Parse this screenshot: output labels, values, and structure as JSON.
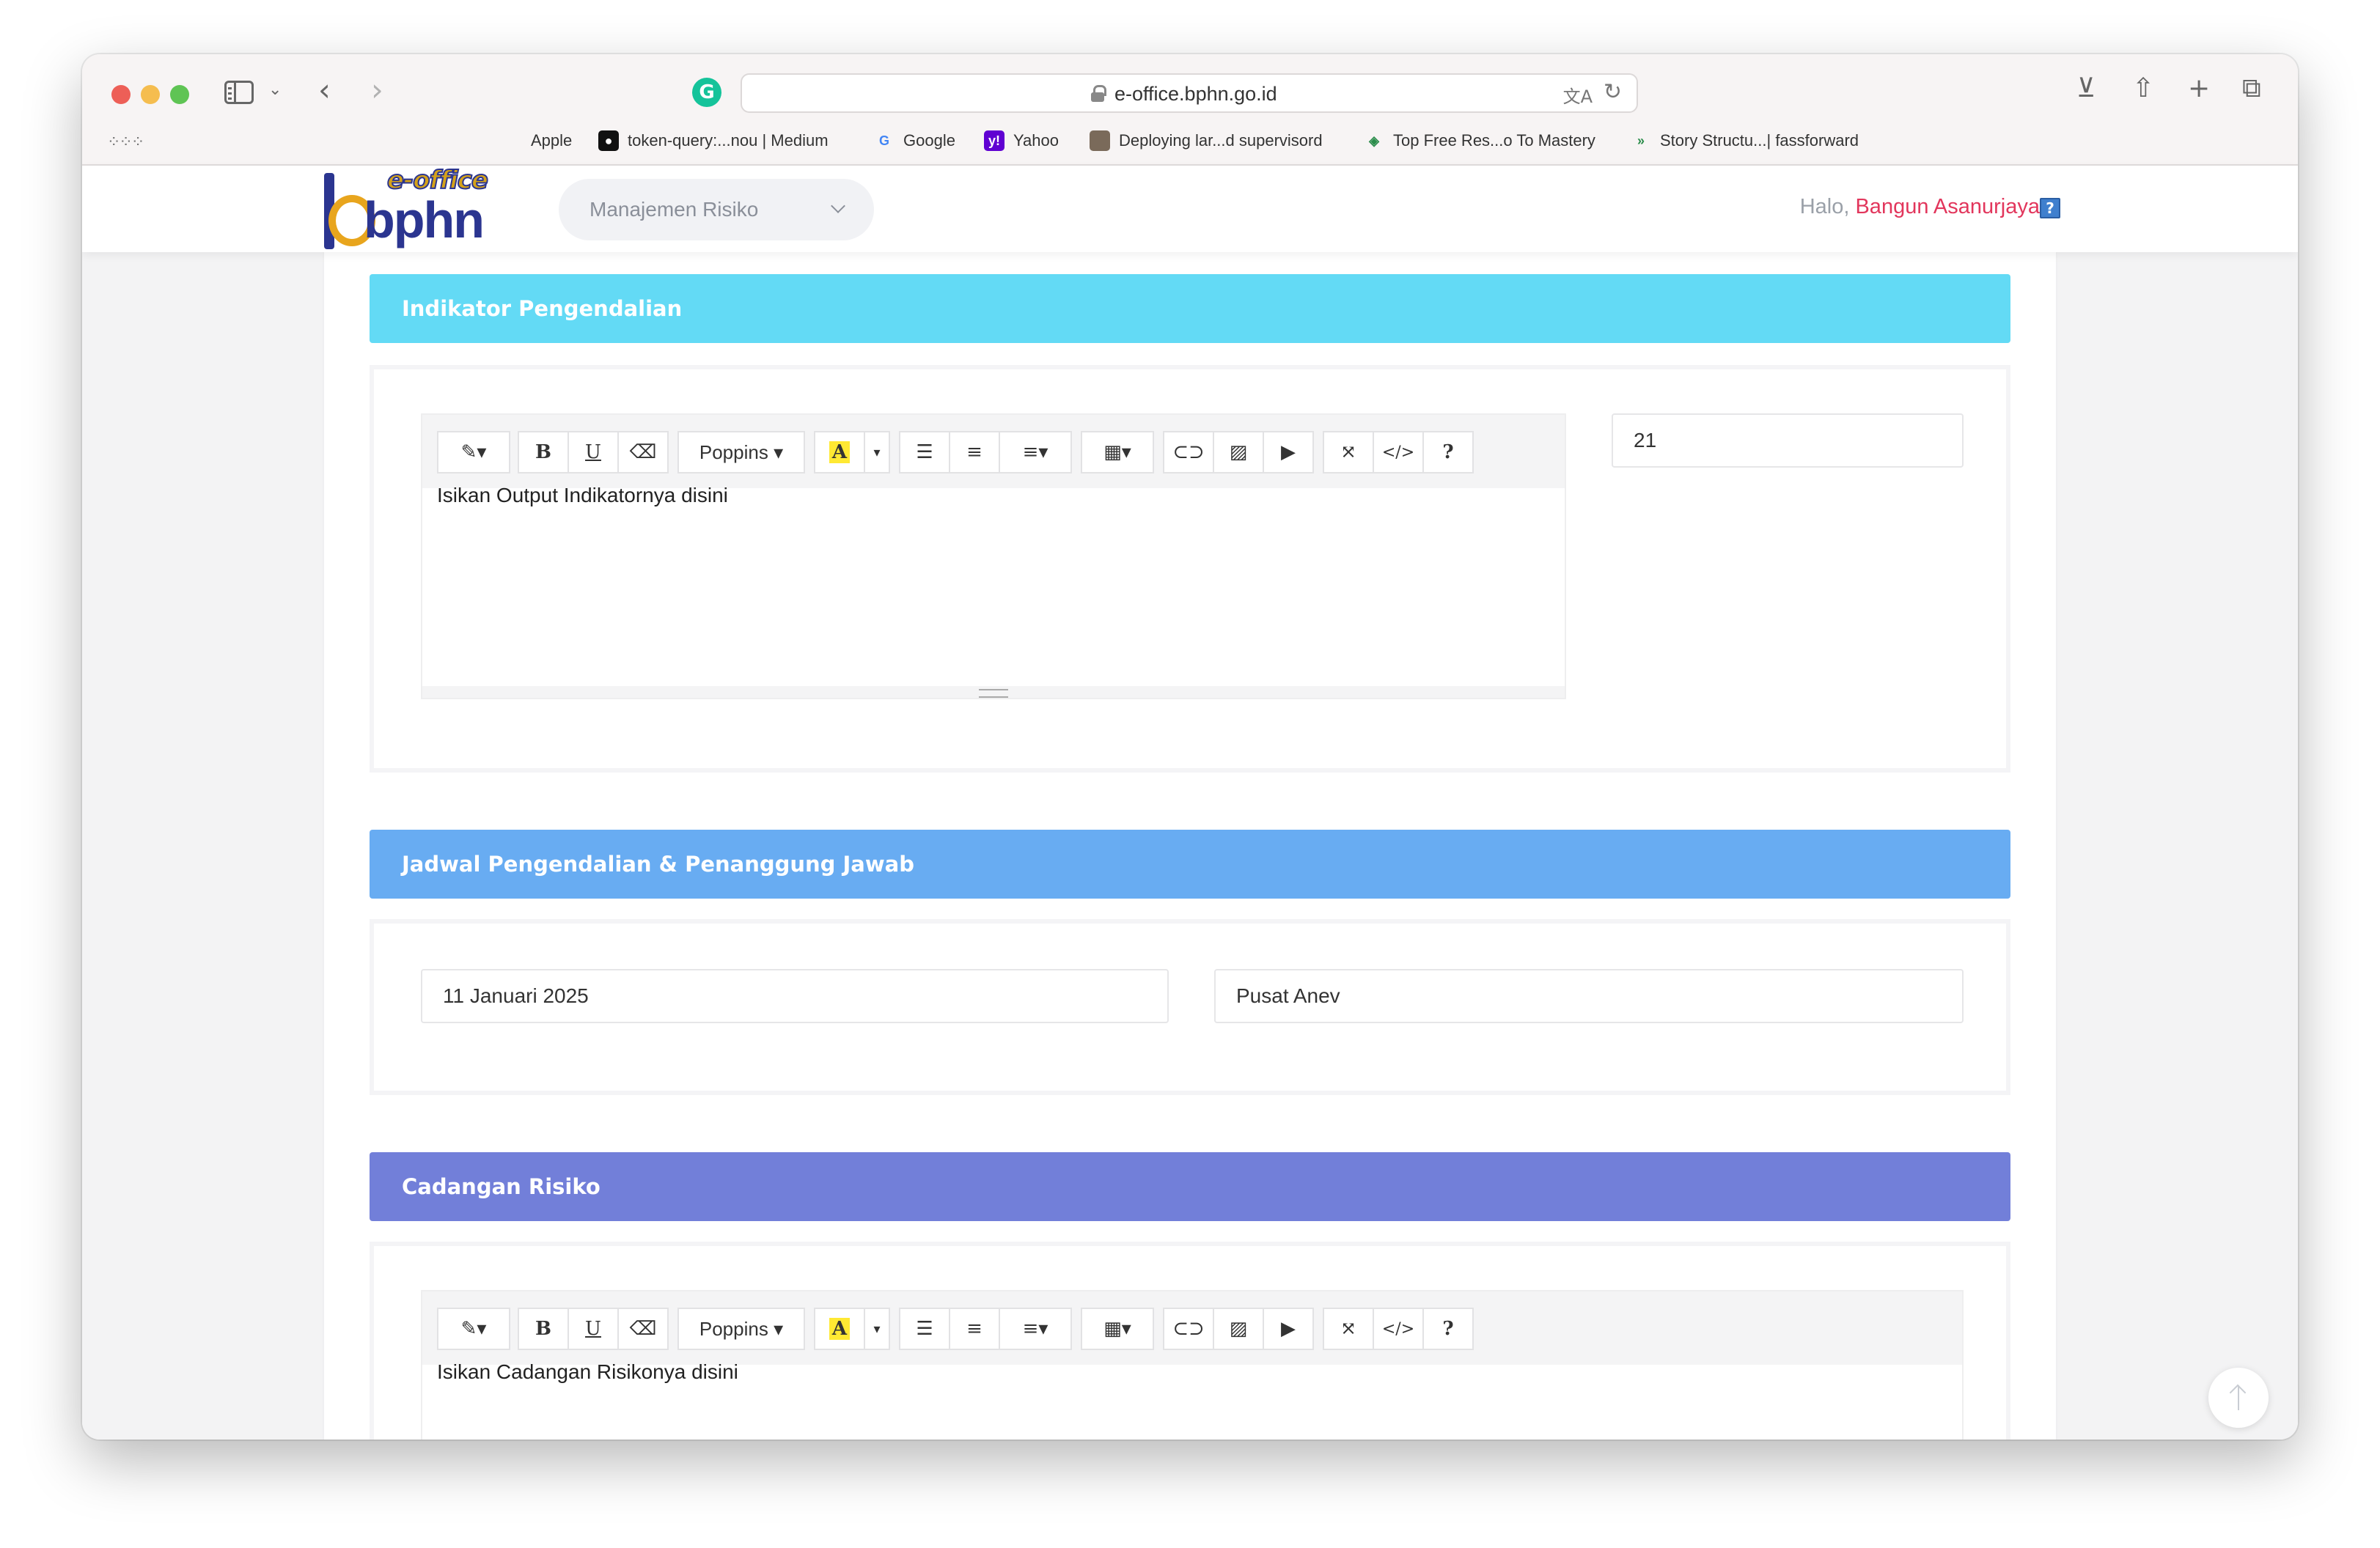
{
  "browser": {
    "url": "e-office.bphn.go.id",
    "bookmarks": [
      {
        "label": "Apple",
        "icon": "apple-icon"
      },
      {
        "label": "token-query:...nou | Medium",
        "icon": "medium-icon"
      },
      {
        "label": "Google",
        "icon": "google-icon"
      },
      {
        "label": "Yahoo",
        "icon": "yahoo-icon"
      },
      {
        "label": "Deploying lar...d supervisord",
        "icon": "avatar-icon"
      },
      {
        "label": "Top Free Res...o To Mastery",
        "icon": "ztm-icon"
      },
      {
        "label": "Story Structu...| fassforward",
        "icon": "arrows-icon"
      }
    ]
  },
  "header": {
    "logo_top": "e-office",
    "logo_main": "bphn",
    "module": "Manajemen Risiko",
    "greeting": "Halo,",
    "user": "Bangun Asanurjaya",
    "help": "?"
  },
  "sections": {
    "indikator": {
      "title": "Indikator Pengendalian",
      "editor_text": "Isikan Output Indikatornya disini",
      "value": "21"
    },
    "jadwal": {
      "title": "Jadwal Pengendalian & Penanggung Jawab",
      "date": "11 Januari 2025",
      "responsible": "Pusat Anev"
    },
    "cadangan": {
      "title": "Cadangan Risiko",
      "editor_text": "Isikan Cadangan Risikonya disini"
    }
  },
  "editor_toolbar": {
    "font_label": "Poppins",
    "bold": "B",
    "underline": "U",
    "help": "?",
    "code": "</>"
  },
  "colors": {
    "section_indikator": "#63daf5",
    "section_jadwal": "#68acf2",
    "section_cadangan": "#727fd9",
    "user_name": "#e2365c",
    "logo_blue": "#2b3590",
    "logo_gold": "#e8a51d"
  }
}
